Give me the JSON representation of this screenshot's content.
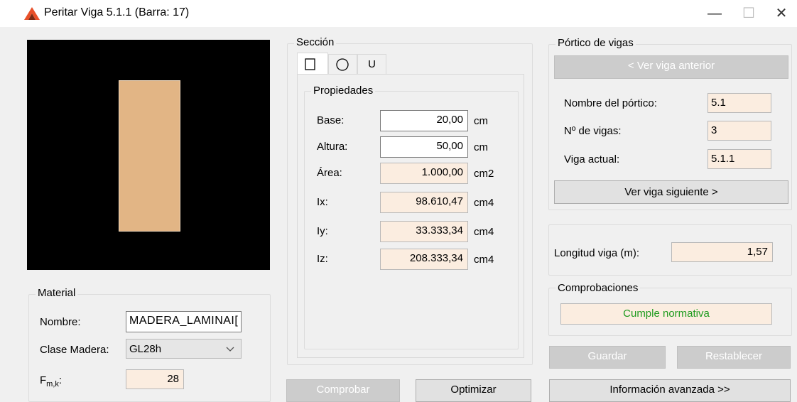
{
  "window": {
    "title": "Peritar Viga 5.1.1 (Barra: 17)",
    "minimize": "—",
    "maximize": "☐",
    "close": "✕"
  },
  "preview": {
    "fill_color": "#e2b585",
    "background": "#000000"
  },
  "material": {
    "group_title": "Material",
    "nombre_label": "Nombre:",
    "nombre_value": "MADERA_LAMINAI[",
    "clase_label": "Clase Madera:",
    "clase_value": "GL28h",
    "fmk_label": "F",
    "fmk_sub": "m,k",
    "fmk_colon": ":",
    "fmk_value": "28"
  },
  "seccion": {
    "group_title": "Sección",
    "tabs": [
      {
        "name": "rectangle",
        "label": "□"
      },
      {
        "name": "circle",
        "label": "○"
      },
      {
        "name": "u",
        "label": "U"
      }
    ],
    "props_title": "Propiedades",
    "rows": [
      {
        "label": "Base:",
        "value": "20,00",
        "unit": "cm",
        "editable": true
      },
      {
        "label": "Altura:",
        "value": "50,00",
        "unit": "cm",
        "editable": true
      },
      {
        "label": "Área:",
        "value": "1.000,00",
        "unit": "cm2",
        "editable": false
      },
      {
        "label": "Ix:",
        "value": "98.610,47",
        "unit": "cm4",
        "editable": false
      },
      {
        "label": "Iy:",
        "value": "33.333,34",
        "unit": "cm4",
        "editable": false
      },
      {
        "label": "Iz:",
        "value": "208.333,34",
        "unit": "cm4",
        "editable": false
      }
    ]
  },
  "buttons": {
    "comprobar": "Comprobar",
    "optimizar": "Optimizar",
    "guardar": "Guardar",
    "restablecer": "Restablecer",
    "info": "Información avanzada >>"
  },
  "portico": {
    "group_title": "Pórtico de vigas",
    "prev_btn": "< Ver viga anterior",
    "next_btn": "Ver viga siguiente >",
    "nombre_label": "Nombre del pórtico:",
    "nombre_value": "5.1",
    "nvigas_label": "Nº de vigas:",
    "nvigas_value": "3",
    "actual_label": "Viga actual:",
    "actual_value": "5.1.1"
  },
  "longitud": {
    "label": "Longitud viga (m):",
    "value": "1,57"
  },
  "comprobaciones": {
    "group_title": "Comprobaciones",
    "status": "Cumple normativa",
    "status_color": "#1e9b1e"
  }
}
